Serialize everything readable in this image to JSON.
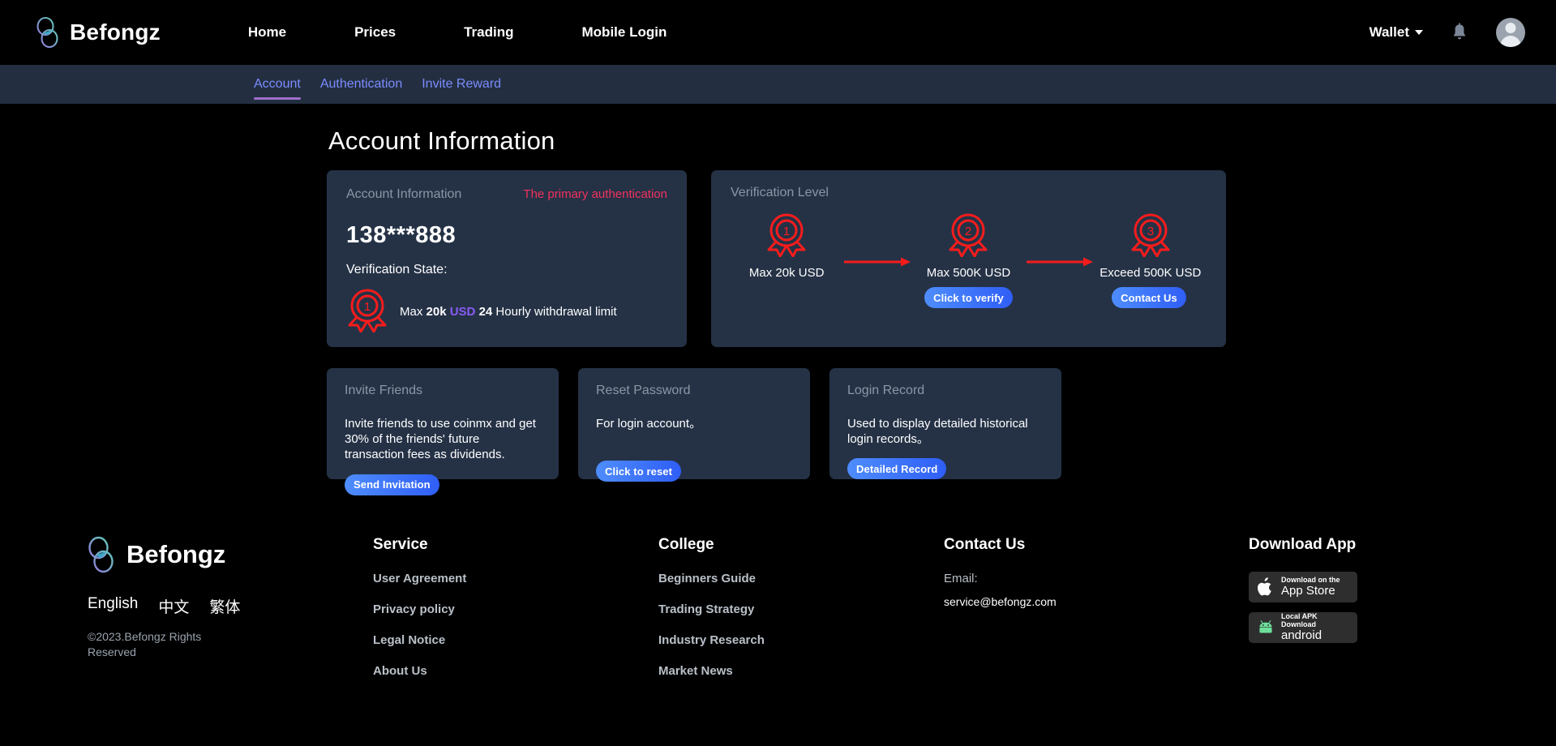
{
  "header": {
    "brand": "Befongz",
    "brand_logo_icon": "befongz-b-logo",
    "nav": [
      {
        "label": "Home"
      },
      {
        "label": "Prices"
      },
      {
        "label": "Trading"
      },
      {
        "label": "Mobile Login"
      }
    ],
    "wallet_label": "Wallet",
    "wallet_caret_icon": "chevron-down-icon",
    "notification_icon": "bell-icon",
    "avatar_icon": "user-avatar"
  },
  "subnav": {
    "tabs": [
      {
        "label": "Account",
        "active": true
      },
      {
        "label": "Authentication",
        "active": false
      },
      {
        "label": "Invite Reward",
        "active": false
      }
    ]
  },
  "main": {
    "page_title": "Account Information",
    "account_card": {
      "title": "Account Information",
      "status": "The primary authentication",
      "account_number": "138***888",
      "verification_state_label": "Verification State:",
      "medal_icon": "medal-rank-1-icon",
      "limit_prefix": "Max ",
      "limit_amount": "20k",
      "limit_currency": "USD",
      "limit_hours": "24",
      "limit_suffix": " Hourly withdrawal limit"
    },
    "verification_card": {
      "title": "Verification Level",
      "levels": [
        {
          "icon": "medal-rank-1-icon",
          "number": "1",
          "label": "Max 20k USD",
          "button": null
        },
        {
          "icon": "medal-rank-2-icon",
          "number": "2",
          "label": "Max 500K USD",
          "button": "Click to verify"
        },
        {
          "icon": "medal-rank-3-icon",
          "number": "3",
          "label": "Exceed 500K USD",
          "button": "Contact Us"
        }
      ]
    },
    "small_cards": [
      {
        "title": "Invite Friends",
        "desc": "Invite friends to use coinmx and get 30% of the friends' future transaction fees as dividends.",
        "button": "Send Invitation"
      },
      {
        "title": "Reset Password",
        "desc": "For login account。",
        "button": "Click to reset"
      },
      {
        "title": "Login Record",
        "desc": "Used to display detailed historical login records。",
        "button": "Detailed Record"
      }
    ]
  },
  "footer": {
    "brand": "Befongz",
    "brand_logo_icon": "befongz-b-logo",
    "languages": [
      {
        "label": "English"
      },
      {
        "label": "中文"
      },
      {
        "label": "繁体"
      }
    ],
    "copyright": "©2023.Befongz Rights Reserved",
    "service": {
      "heading": "Service",
      "links": [
        {
          "label": "User Agreement"
        },
        {
          "label": "Privacy policy"
        },
        {
          "label": "Legal Notice"
        },
        {
          "label": "About Us"
        }
      ]
    },
    "college": {
      "heading": "College",
      "links": [
        {
          "label": "Beginners Guide"
        },
        {
          "label": "Trading Strategy"
        },
        {
          "label": "Industry Research"
        },
        {
          "label": "Market News"
        }
      ]
    },
    "contact": {
      "heading": "Contact Us",
      "email_label": "Email:",
      "email": "service@befongz.com"
    },
    "download": {
      "heading": "Download App",
      "buttons": [
        {
          "icon": "apple-icon",
          "small": "Download on the",
          "big": "App Store"
        },
        {
          "icon": "android-icon",
          "small": "Local APK Download",
          "big": "android"
        }
      ]
    }
  },
  "colors": {
    "page_bg": "#000000",
    "subnav_bg": "#232f40",
    "card_bg": "#253246",
    "accent_red": "#f2315e",
    "medal_red": "#f71c1c",
    "link_blue": "#7b8cff",
    "tab_underline": "#a06ecb",
    "button_blue": "#3f73f9",
    "usd_purple": "#8a5cf6",
    "android_green": "#6ddf9a"
  }
}
